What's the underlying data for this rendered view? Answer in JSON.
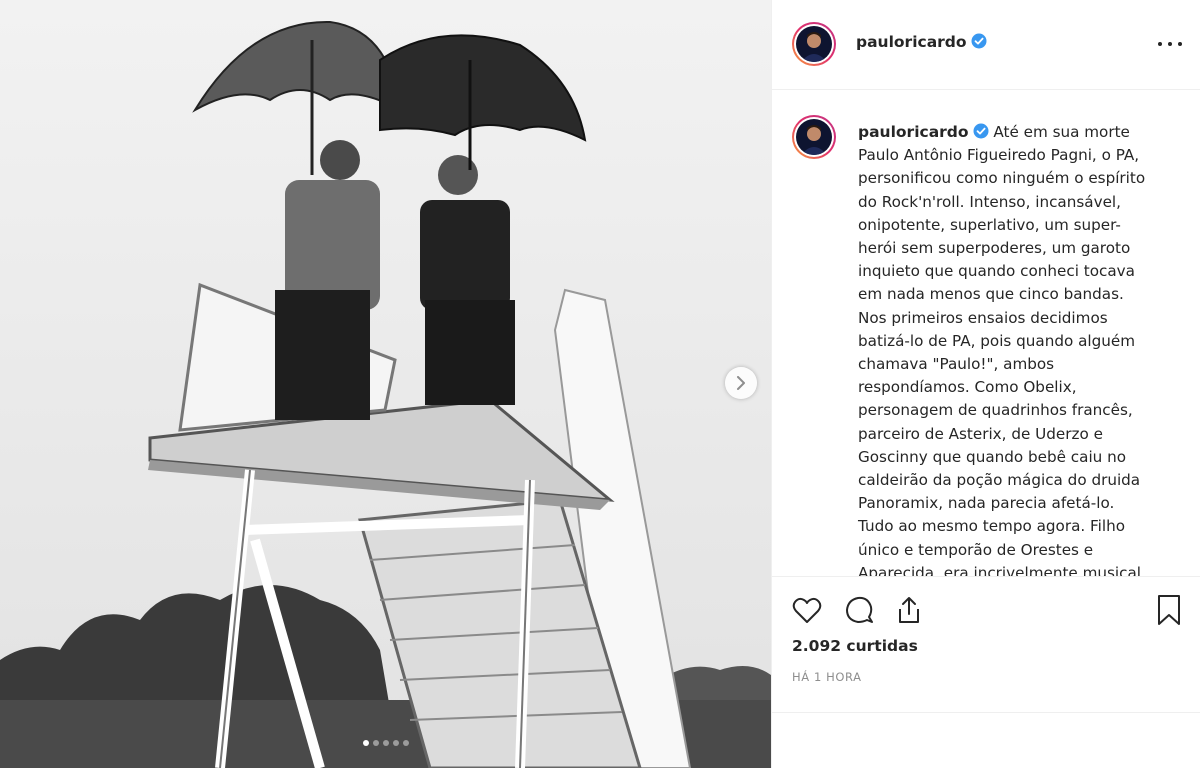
{
  "post": {
    "username": "pauloricardo",
    "caption": "Até em sua morte Paulo Antônio Figueiredo Pagni, o PA, personificou como ninguém o espírito do Rock'n'roll. Intenso, incansável, onipotente, superlativo, um super-herói sem superpoderes, um garoto inquieto que quando conheci tocava em nada menos que cinco bandas. Nos primeiros ensaios decidimos batizá-lo de PA, pois quando alguém chamava \"Paulo!\", ambos respondíamos. Como Obelix, personagem de quadrinhos francês, parceiro de Asterix, de Uderzo e Goscinny que quando bebê caiu no caldeirão da poção mágica do druida Panoramix, nada parecia afetá-lo. Tudo ao mesmo tempo agora. Filho único e temporão de Orestes e Aparecida, era incrivelmente musical e",
    "likes": "2.092 curtidas",
    "time": "HÁ 1 HORA"
  },
  "carousel": {
    "slide_count": 5,
    "active_index": 0
  },
  "icons": {
    "verified": "verified-badge-icon",
    "more": "more-options-icon",
    "next": "chevron-right-icon",
    "like": "heart-icon",
    "comment": "comment-icon",
    "share": "share-icon",
    "save": "bookmark-icon"
  },
  "colors": {
    "verified_blue": "#3897f0",
    "text": "#262626",
    "muted": "#8e8e8e",
    "border": "#efefef"
  }
}
